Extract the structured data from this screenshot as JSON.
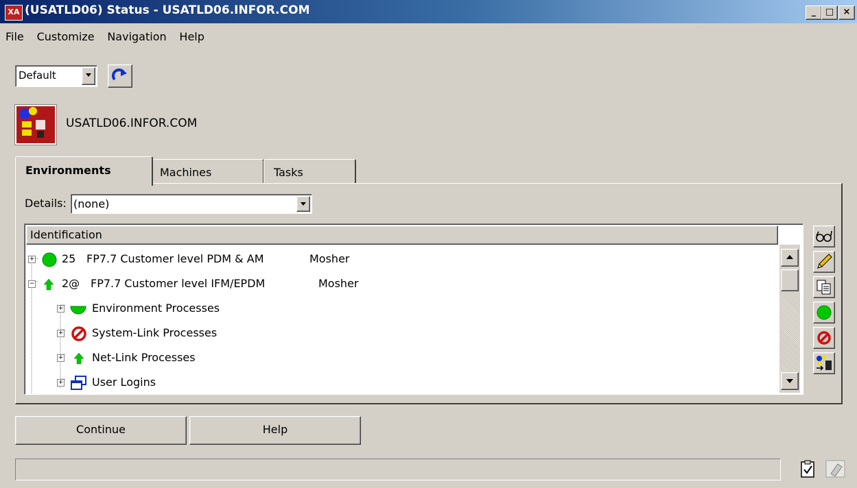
{
  "window": {
    "app_badge": "XA",
    "title": "(USATLD06) Status - USATLD06.INFOR.COM",
    "controls": {
      "minimize": "_",
      "maximize": "□",
      "close": "×"
    }
  },
  "menu": [
    "File",
    "Customize",
    "Navigation",
    "Help"
  ],
  "toolbar": {
    "view_select": "Default",
    "refresh_icon": "refresh-icon"
  },
  "server": {
    "name": "USATLD06.INFOR.COM",
    "icon": "server-status-icon"
  },
  "tabs": [
    {
      "label": "Environments",
      "active": true
    },
    {
      "label": "Machines",
      "active": false
    },
    {
      "label": "Tasks",
      "active": false
    }
  ],
  "details": {
    "label": "Details:",
    "value": "(none)"
  },
  "tree": {
    "header": "Identification",
    "rows": [
      {
        "id": "25",
        "name": "FP7.7 Customer level PDM & AM",
        "owner": "Mosher",
        "status_icon": "green-circle-icon",
        "expanded": false
      },
      {
        "id": "2@",
        "name": "FP7.7 Customer level IFM/EPDM",
        "owner": "Mosher",
        "status_icon": "green-arrow-up-icon",
        "expanded": true
      },
      {
        "label": "Environment Processes",
        "status_icon": "green-half-circle-icon"
      },
      {
        "label": "System-Link Processes",
        "status_icon": "red-stop-icon"
      },
      {
        "label": "Net-Link Processes",
        "status_icon": "green-arrow-up-icon"
      },
      {
        "label": "User Logins",
        "status_icon": "user-logins-icon"
      }
    ]
  },
  "side_toolbar": [
    "view-glasses-icon",
    "edit-pencil-icon",
    "copy-icon",
    "start-green-icon",
    "stop-red-icon",
    "transfer-icon"
  ],
  "buttons": {
    "continue": "Continue",
    "help": "Help"
  },
  "statusbar": {
    "text": "",
    "icons": [
      "clipboard-check-icon",
      "eraser-icon"
    ]
  },
  "colors": {
    "titlebar_start": "#0a246a",
    "titlebar_end": "#a6caf0",
    "face": "#d4d0c8",
    "green": "#00c800",
    "red": "#d01010"
  }
}
